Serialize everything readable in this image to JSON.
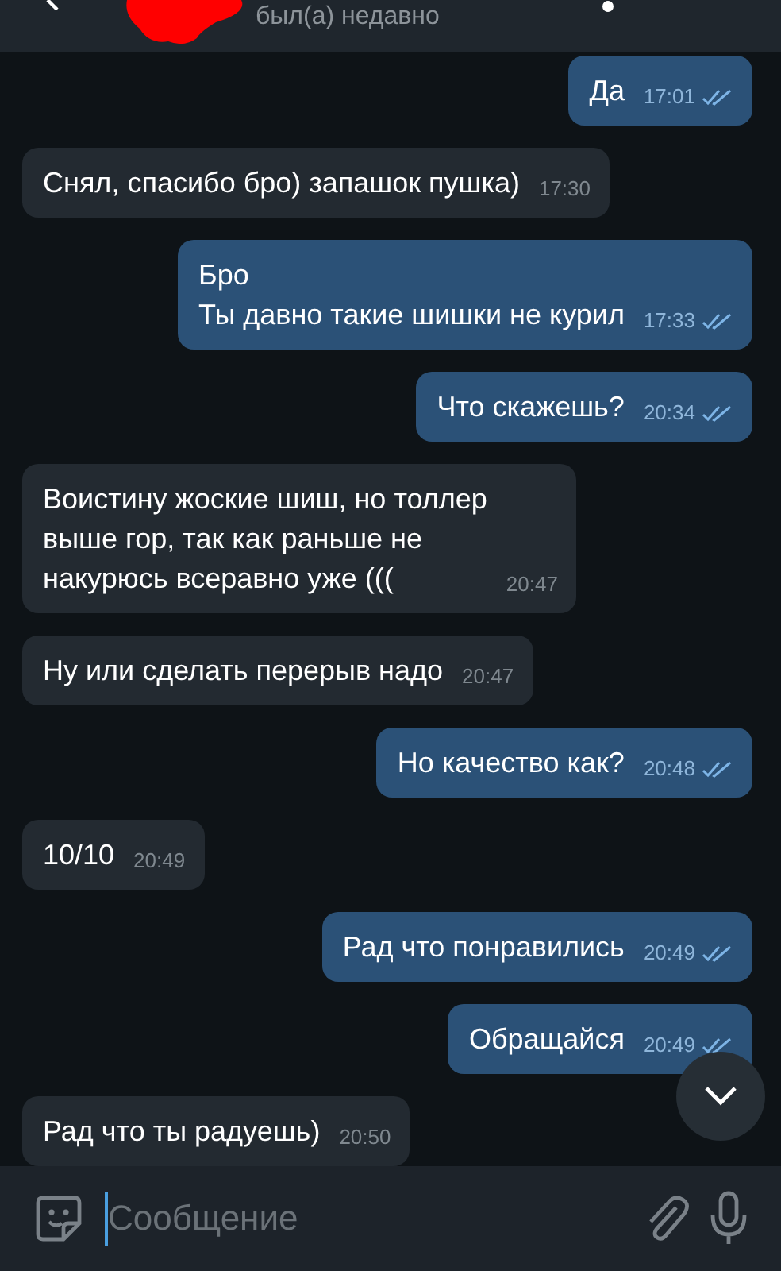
{
  "header": {
    "status": "был(а) недавно"
  },
  "messages": [
    {
      "outgoing": true,
      "text": "Да",
      "time": "17:01",
      "read": true
    },
    {
      "outgoing": false,
      "text": "Снял, спасибо бро) запашок пушка)",
      "time": "17:30"
    },
    {
      "outgoing": true,
      "text": "Бро\nТы давно такие шишки не курил",
      "time": "17:33",
      "read": true
    },
    {
      "outgoing": true,
      "text": "Что скажешь?",
      "time": "20:34",
      "read": true
    },
    {
      "outgoing": false,
      "text": "Воистину жоские шиш, но толлер\nвыше гор, так как раньше не\nнакурюсь всеравно уже (((",
      "time": "20:47"
    },
    {
      "outgoing": false,
      "text": "Ну или сделать перерыв надо",
      "time": "20:47"
    },
    {
      "outgoing": true,
      "text": "Но качество как?",
      "time": "20:48",
      "read": true
    },
    {
      "outgoing": false,
      "text": "10/10",
      "time": "20:49"
    },
    {
      "outgoing": true,
      "text": "Рад что понравились",
      "time": "20:49",
      "read": true
    },
    {
      "outgoing": true,
      "text": "Обращайся",
      "time": "20:49",
      "read": true
    },
    {
      "outgoing": false,
      "text": "Рад что ты радуешь)",
      "time": "20:50"
    }
  ],
  "composer": {
    "placeholder": "Сообщение"
  }
}
